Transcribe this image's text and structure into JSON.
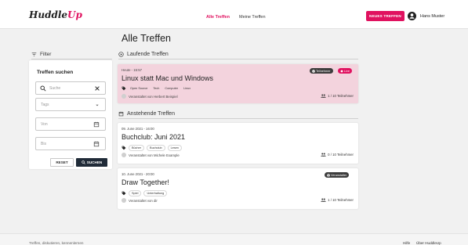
{
  "header": {
    "logo_main": "Huddle",
    "logo_accent": "Up",
    "nav": [
      "Alle Treffen",
      "Meine Treffen"
    ],
    "new_button": "NEUES TREFFEN",
    "user_name": "Hans Muster",
    "accent_color": "#e0115f"
  },
  "filter": {
    "heading": "Filter",
    "title": "Treffen suchen",
    "search_placeholder": "Suche",
    "tags_placeholder": "Tags",
    "from_placeholder": "Von",
    "to_placeholder": "Bis",
    "reset_label": "RESET",
    "search_label": "SUCHEN"
  },
  "main": {
    "title": "Alle Treffen",
    "running_heading": "Laufende Treffen",
    "upcoming_heading": "Anstehende Treffen",
    "running": [
      {
        "date": "Heute - 15:57",
        "title": "Linux statt Mac und Windows",
        "tags": [
          "Open Source",
          "Tech",
          "Computer",
          "Linux"
        ],
        "organizer": "Veranstaltet von Herbert Beispiel",
        "participants": "1 / 10 Teilnehmer",
        "badge_participant": "Teilnehmer",
        "badge_live": "Live"
      }
    ],
    "upcoming": [
      {
        "date": "09. June 2021 - 16:00",
        "title": "Buchclub: Juni 2021",
        "tags": [
          "Bücher",
          "Buchclub",
          "Lesen"
        ],
        "organizer": "Veranstaltet von Michele Example",
        "participants": "0 / 10 Teilnehmer"
      },
      {
        "date": "10. June 2021 - 20:00",
        "title": "Draw Together!",
        "tags": [
          "Spiel",
          "Unterhaltung"
        ],
        "organizer": "Veranstaltet von dir",
        "participants": "1 / 10 Teilnehmer",
        "badge_organizer": "Veranstalter"
      }
    ]
  },
  "footer": {
    "tagline": "Treffen, diskutieren, kennenlernen",
    "links": [
      "Hilfe",
      "Über HuddleUp"
    ]
  }
}
